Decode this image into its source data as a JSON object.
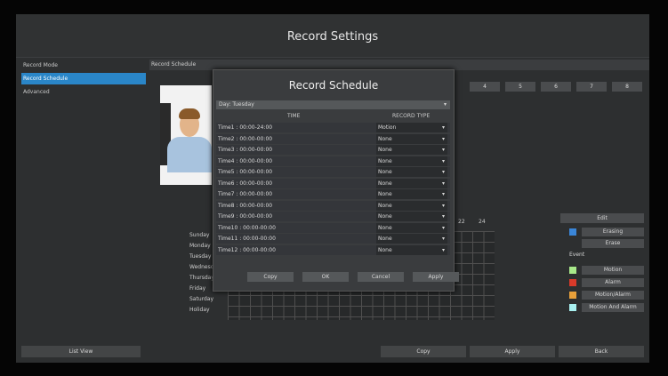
{
  "window": {
    "title": "Record Settings"
  },
  "sidebar": {
    "items": [
      {
        "label": "Record Mode",
        "active": false
      },
      {
        "label": "Record Schedule",
        "active": true
      },
      {
        "label": "Advanced",
        "active": false
      }
    ],
    "list_view_label": "List View"
  },
  "main": {
    "section_label": "Record Schedule",
    "channel_buttons": [
      "4",
      "5",
      "6",
      "7",
      "8"
    ],
    "days": [
      "Sunday",
      "Monday",
      "Tuesday",
      "Wednesday",
      "Thursday",
      "Friday",
      "Saturday",
      "Holiday"
    ],
    "hour_labels": [
      "22",
      "24"
    ]
  },
  "right_panel": {
    "edit_label": "Edit",
    "mode_items": [
      {
        "label": "Erasing",
        "color": "#3a86d8"
      },
      {
        "label": "Erase",
        "color": "#2d2f30"
      }
    ],
    "event_label": "Event",
    "legend": [
      {
        "label": "Motion",
        "color": "#a8e88a"
      },
      {
        "label": "Alarm",
        "color": "#d83a2a"
      },
      {
        "label": "Motion/Alarm",
        "color": "#e8a03a"
      },
      {
        "label": "Motion And Alarm",
        "color": "#a8f0f0"
      }
    ]
  },
  "bottom_buttons": {
    "copy": "Copy",
    "apply": "Apply",
    "back": "Back"
  },
  "dialog": {
    "title": "Record Schedule",
    "day_label": "Day",
    "day_value": "Tuesday",
    "col_time": "TIME",
    "col_type": "RECORD TYPE",
    "rows": [
      {
        "label": "Time1 : 00:00-24:00",
        "type": "Motion"
      },
      {
        "label": "Time2 : 00:00-00:00",
        "type": "None"
      },
      {
        "label": "Time3 : 00:00-00:00",
        "type": "None"
      },
      {
        "label": "Time4 : 00:00-00:00",
        "type": "None"
      },
      {
        "label": "Time5 : 00:00-00:00",
        "type": "None"
      },
      {
        "label": "Time6 : 00:00-00:00",
        "type": "None"
      },
      {
        "label": "Time7 : 00:00-00:00",
        "type": "None"
      },
      {
        "label": "Time8 : 00:00-00:00",
        "type": "None"
      },
      {
        "label": "Time9 : 00:00-00:00",
        "type": "None"
      },
      {
        "label": "Time10 : 00:00-00:00",
        "type": "None"
      },
      {
        "label": "Time11 : 00:00-00:00",
        "type": "None"
      },
      {
        "label": "Time12 : 00:00-00:00",
        "type": "None"
      }
    ],
    "buttons": {
      "copy": "Copy",
      "ok": "OK",
      "cancel": "Cancel",
      "apply": "Apply"
    }
  }
}
